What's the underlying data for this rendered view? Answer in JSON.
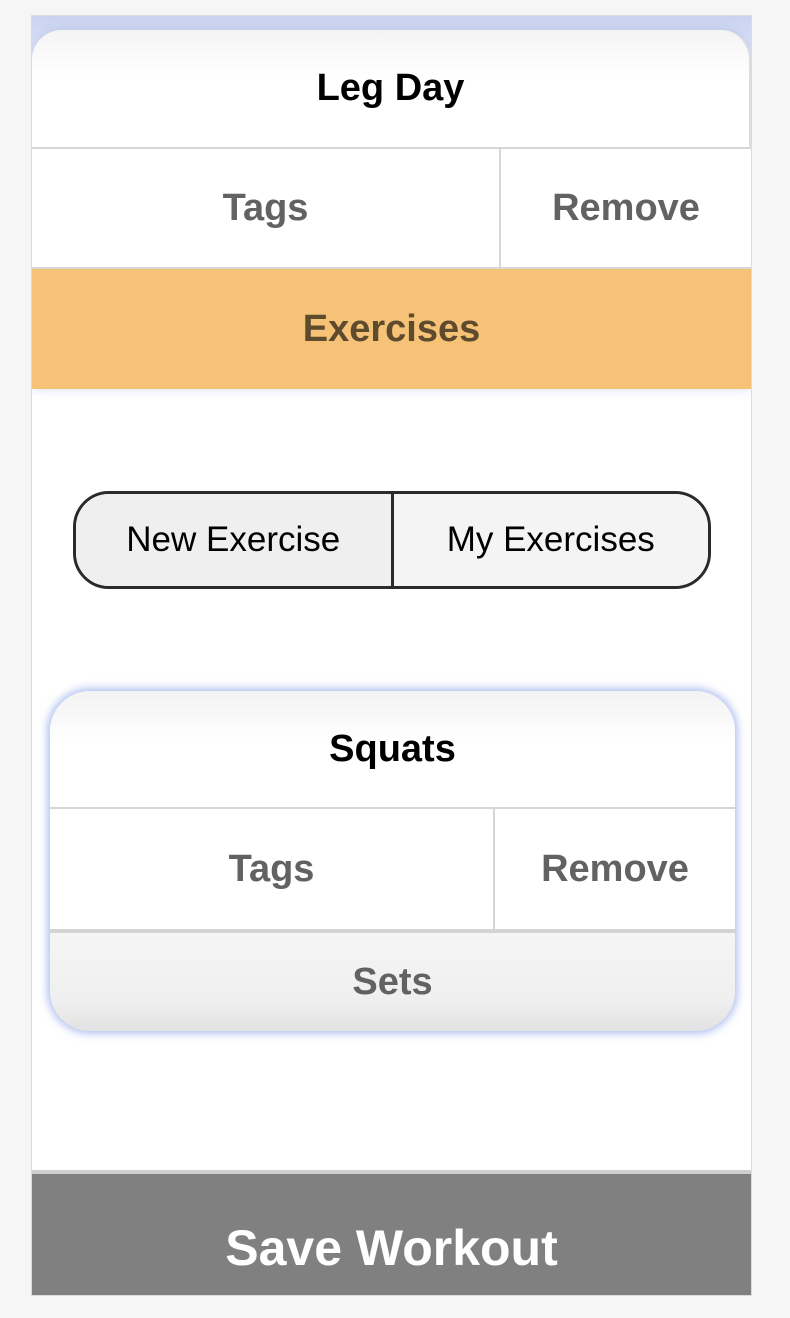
{
  "workout": {
    "title": "Leg Day",
    "tags_label": "Tags",
    "remove_label": "Remove",
    "exercises_label": "Exercises"
  },
  "exercise_picker": {
    "new_label": "New Exercise",
    "mine_label": "My Exercises"
  },
  "exercise": {
    "title": "Squats",
    "tags_label": "Tags",
    "remove_label": "Remove",
    "sets_label": "Sets"
  },
  "save": {
    "label": "Save Workout"
  },
  "colors": {
    "exercises_bar": "#f5c277",
    "save_bar": "#808080",
    "card_glow": "#7891e6"
  }
}
